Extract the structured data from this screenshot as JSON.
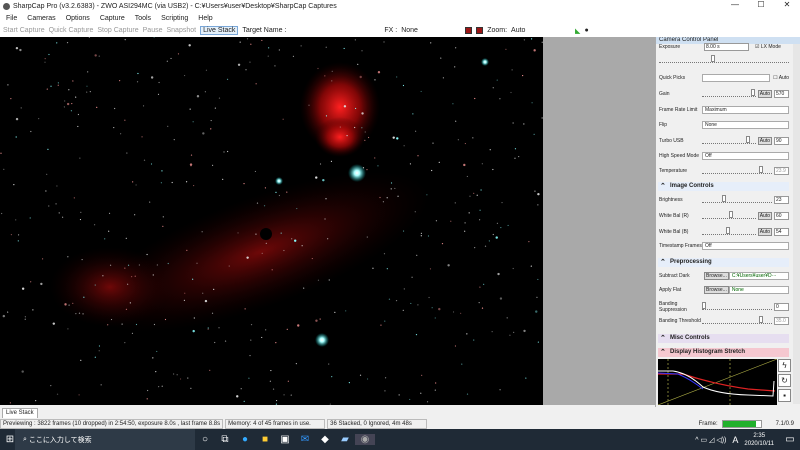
{
  "window": {
    "title": "SharpCap Pro (v3.2.6383) - ZWO ASI294MC (via USB2) - C:¥Users¥user¥Desktop¥SharpCap Captures",
    "minimize": "—",
    "maximize": "☐",
    "close": "✕"
  },
  "menu": [
    "File",
    "Cameras",
    "Options",
    "Capture",
    "Tools",
    "Scripting",
    "Help"
  ],
  "toolbar": {
    "start_capture": "Start Capture",
    "quick_capture": "Quick Capture",
    "stop_capture": "Stop Capture",
    "pause": "Pause",
    "snapshot": "Snapshot",
    "live_stack": "Live Stack",
    "target_name_label": "Target Name :",
    "fx_label": "FX :",
    "fx_value": "None",
    "zoom_label": "Zoom:",
    "zoom_value": "Auto"
  },
  "panel": {
    "title": "Camera Control Panel",
    "exposure_label": "Exposure",
    "exposure_value": "8.00 s",
    "lx_mode": "LX Mode",
    "quick_picks": "Quick Picks",
    "quick_picks_auto": "Auto",
    "gain": {
      "label": "Gain",
      "auto": "Auto",
      "value": "570",
      "level": 0.95
    },
    "frame_rate": {
      "label": "Frame Rate Limit",
      "value": "Maximum"
    },
    "flip": {
      "label": "Flip",
      "value": "None"
    },
    "turbo_usb": {
      "label": "Turbo USB",
      "auto": "Auto",
      "value": "90",
      "level": 0.85
    },
    "high_speed": {
      "label": "High Speed Mode",
      "value": "Off"
    },
    "temperature": {
      "label": "Temperature",
      "value": "23.9",
      "level": 0.85
    },
    "image_controls": "Image Controls",
    "brightness": {
      "label": "Brightness",
      "value": "23",
      "level": 0.3
    },
    "wb_r": {
      "label": "White Bal (R)",
      "auto": "Auto",
      "value": "60",
      "level": 0.5
    },
    "wb_b": {
      "label": "White Bal (B)",
      "auto": "Auto",
      "value": "54",
      "level": 0.45
    },
    "timestamp": {
      "label": "Timestamp Frames",
      "value": "Off"
    },
    "preprocessing": "Preprocessing",
    "subtract_dark": {
      "label": "Subtract Dark",
      "browse": "Browse...",
      "value": "C:¥Users¥user¥D···"
    },
    "apply_flat": {
      "label": "Apply Flat",
      "browse": "Browse...",
      "value": "None"
    },
    "banding_suppression": {
      "label": "Banding Suppression",
      "value": "0",
      "level": 0
    },
    "banding_threshold": {
      "label": "Banding Threshold",
      "value": "35.0",
      "level": 0.85
    },
    "misc_controls": "Misc Controls",
    "histogram": "Display Histogram Stretch"
  },
  "tab": "Live Stack",
  "status": {
    "preview": "Previewing : 3822 frames (10 dropped) in 2:54:50, exposure 8.0s , last frame 8.8s",
    "memory": "Memory: 4 of 45 frames in use.",
    "stacked": "36 Stacked, 0 Ignored, 4m 48s",
    "frame_label": "Frame:",
    "frame_value": "7.1/0.9",
    "frame_progress": 0.88
  },
  "taskbar": {
    "search_placeholder": "ここに入力して検索",
    "time": "2:35",
    "date": "2020/10/11",
    "ime": "A"
  },
  "colors": {
    "accent": "#0078d7",
    "frame_bar": "#22b02c",
    "section_blue": "#e6eefa",
    "section_purple": "#e6def0",
    "section_pink": "#f5c8d0"
  }
}
